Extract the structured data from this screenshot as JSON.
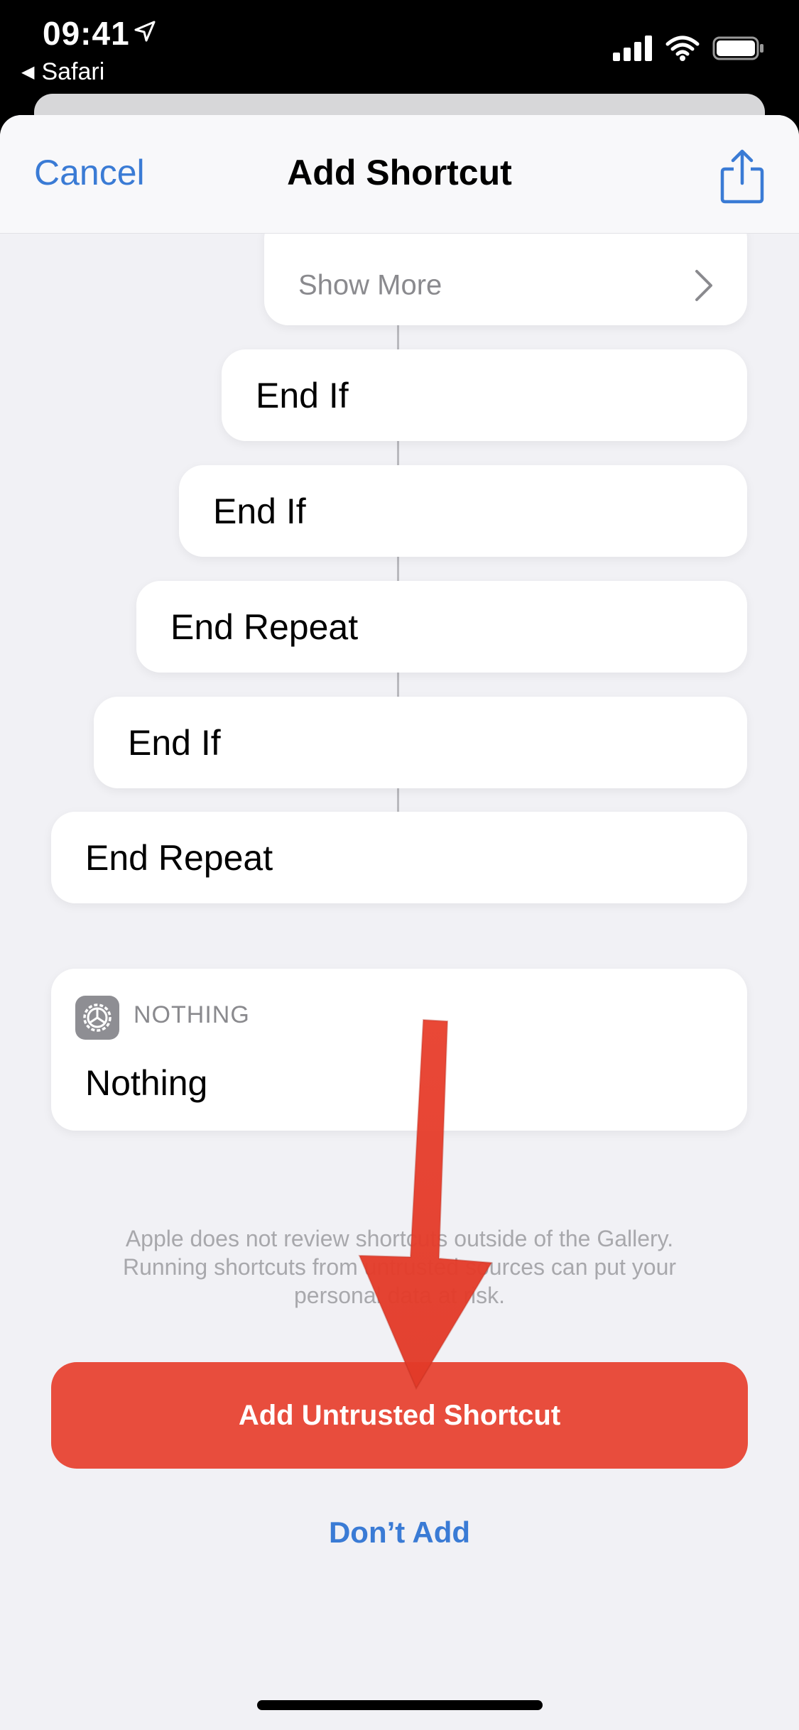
{
  "status_bar": {
    "time": "09:41",
    "back_app": "Safari"
  },
  "nav": {
    "cancel_label": "Cancel",
    "title": "Add Shortcut"
  },
  "actions": {
    "show_more": "Show More",
    "items": [
      "End If",
      "End If",
      "End Repeat",
      "End If",
      "End Repeat"
    ]
  },
  "nothing_card": {
    "caption": "NOTHING",
    "title": "Nothing"
  },
  "warning_lines": [
    "Apple does not review shortcuts outside of the Gallery.",
    "Running shortcuts from untrusted sources can put your",
    "personal data at risk."
  ],
  "buttons": {
    "add_untrusted": "Add Untrusted Shortcut",
    "dont_add": "Don’t Add"
  },
  "colors": {
    "accent_blue": "#3a7bd5",
    "danger_red": "#e84d3d",
    "annotation_arrow": "#e8402e"
  }
}
